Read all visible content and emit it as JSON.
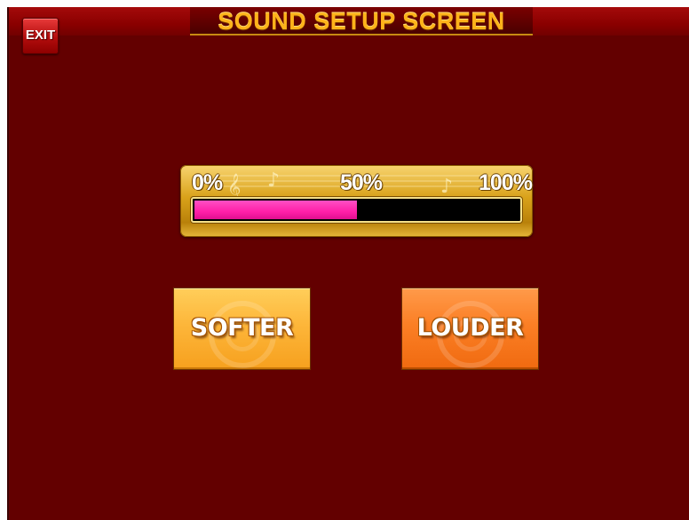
{
  "header": {
    "title": "SOUND SETUP SCREEN"
  },
  "exit_button": {
    "label": "EXIT"
  },
  "volume": {
    "scale_labels": [
      "0%",
      "50%",
      "100%"
    ],
    "level_fraction": 0.5,
    "fill_color": "#ff1fa8",
    "decoration_icons": [
      "music-note-icon",
      "treble-clef-icon"
    ]
  },
  "controls": {
    "softer_label": "SOFTER",
    "louder_label": "LOUDER"
  },
  "colors": {
    "background": "#630000",
    "title_text": "#ffb31a",
    "panel_gold": "#d9a21a",
    "softer_button": "#fdb63a",
    "louder_button": "#fb7f25",
    "exit_button": "#b30d0d"
  }
}
